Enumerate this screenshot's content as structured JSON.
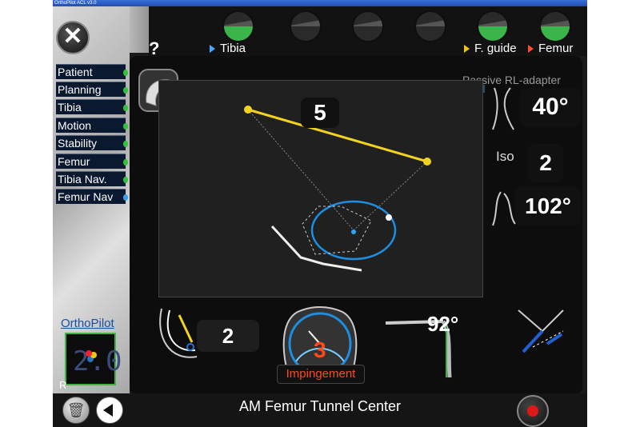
{
  "window": {
    "title": "OrthoPilot ACL v3.0"
  },
  "header": {
    "help_label": "?",
    "indicators": [
      {
        "name": "tibia-indicator",
        "state": "done"
      },
      {
        "name": "indicator-2",
        "state": "off"
      },
      {
        "name": "indicator-3",
        "state": "off"
      },
      {
        "name": "indicator-4",
        "state": "off"
      },
      {
        "name": "f-guide-indicator",
        "state": "done"
      },
      {
        "name": "femur-indicator",
        "state": "done"
      }
    ],
    "labels": {
      "tibia": "Tibia",
      "f_guide": "F. guide",
      "femur": "Femur"
    }
  },
  "sidebar": {
    "items": [
      {
        "label": "Patient",
        "status": "green"
      },
      {
        "label": "Planning",
        "status": "green"
      },
      {
        "label": "Tibia",
        "status": "green"
      },
      {
        "label": "Motion",
        "status": "green"
      },
      {
        "label": "Stability",
        "status": "green"
      },
      {
        "label": "Femur",
        "status": "green"
      },
      {
        "label": "Tibia Nav.",
        "status": "green"
      },
      {
        "label": "Femur Nav",
        "status": "blue"
      }
    ],
    "logo_text": "OrthoPilot",
    "version_text": "2.0",
    "side_letter": "R"
  },
  "main": {
    "adapter_label": "Passive RL-adapter",
    "distance_value": "5",
    "flexion_angle": "40°",
    "iso_label": "Iso",
    "iso_value": "2",
    "rotation_angle": "102°",
    "clock_value": "2",
    "impingement_value": "3",
    "impingement_label": "Impingement",
    "knee_angle": "92°",
    "status_text": "AM Femur Tunnel Center"
  },
  "colors": {
    "accent_green": "#39b54a",
    "accent_blue": "#1f8ee0",
    "line_yellow": "#f4d31f",
    "impingement_red": "#ff4a1c"
  }
}
